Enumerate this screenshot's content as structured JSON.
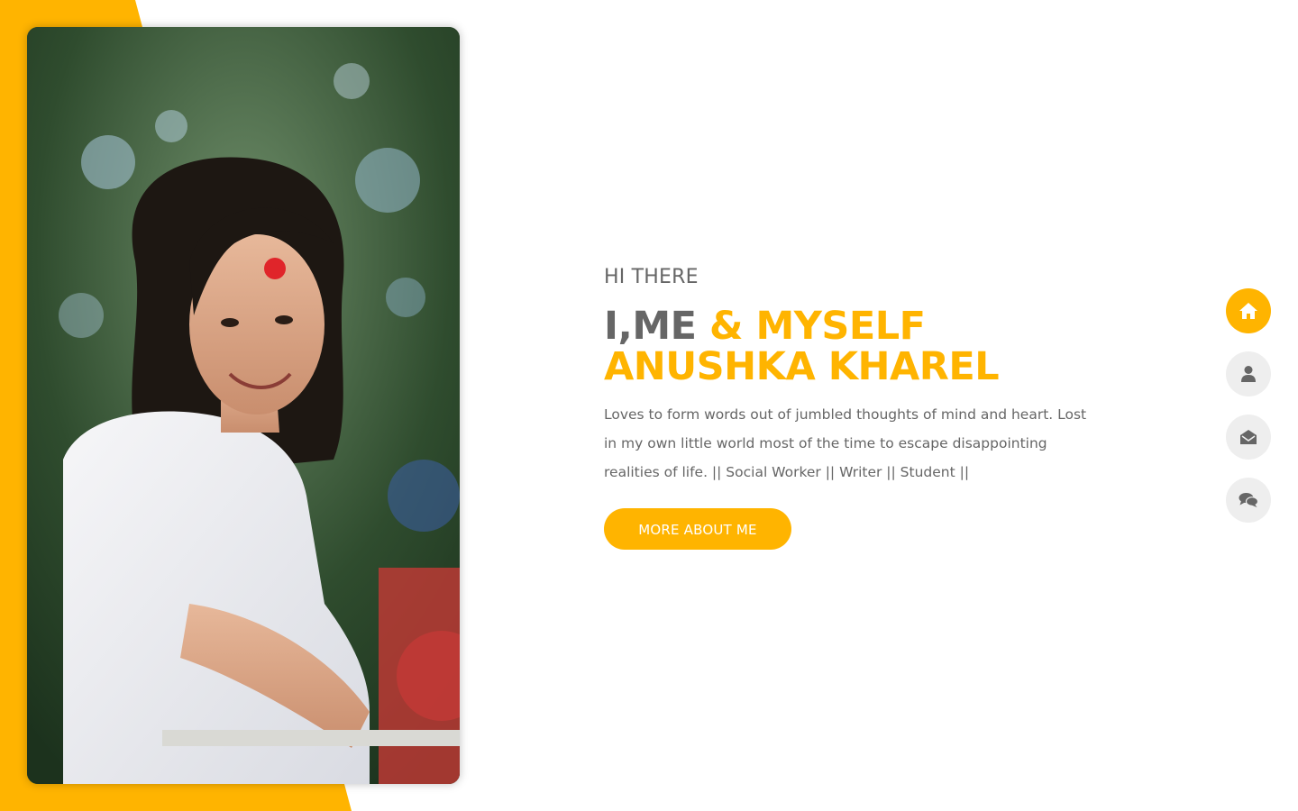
{
  "hero": {
    "greeting": "HI THERE",
    "title_part1": "I,ME",
    "title_part2": "& MYSELF",
    "title_part3": "ANUSHKA KHAREL",
    "bio": "Loves to form words out of jumbled thoughts of mind and heart. Lost in my own little world most of the time to escape disappointing realities of life. || Social Worker || Writer || Student ||",
    "button_label": "MORE ABOUT ME"
  },
  "nav": {
    "items": [
      {
        "icon": "home-icon",
        "active": true
      },
      {
        "icon": "user-icon",
        "active": false
      },
      {
        "icon": "envelope-icon",
        "active": false
      },
      {
        "icon": "comments-icon",
        "active": false
      }
    ]
  },
  "colors": {
    "accent": "#ffb400",
    "text": "#666666",
    "nav_bg": "#eeeeee"
  }
}
